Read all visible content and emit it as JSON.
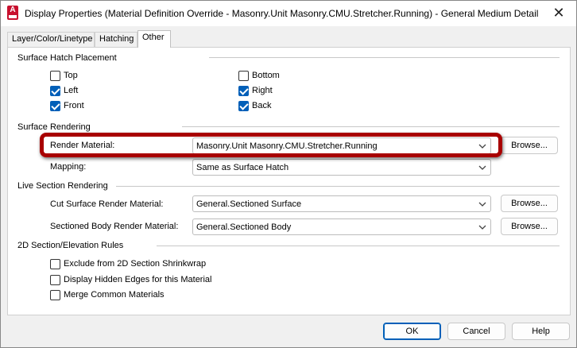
{
  "window": {
    "title": "Display Properties (Material Definition Override - Masonry.Unit Masonry.CMU.Stretcher.Running) - General Medium Detail",
    "app_icon": "autocad-icon",
    "close": "✕"
  },
  "tabs": [
    {
      "label": "Layer/Color/Linetype"
    },
    {
      "label": "Hatching"
    },
    {
      "label": "Other",
      "active": true
    }
  ],
  "surface_hatch": {
    "group_label": "Surface Hatch Placement",
    "options": {
      "top": {
        "label": "Top",
        "checked": false
      },
      "bottom": {
        "label": "Bottom",
        "checked": false
      },
      "left": {
        "label": "Left",
        "checked": true
      },
      "right": {
        "label": "Right",
        "checked": true
      },
      "front": {
        "label": "Front",
        "checked": true
      },
      "back": {
        "label": "Back",
        "checked": true
      }
    }
  },
  "surface_rendering": {
    "group_label": "Surface Rendering",
    "render_material_label": "Render Material:",
    "render_material_value": "Masonry.Unit Masonry.CMU.Stretcher.Running",
    "mapping_label": "Mapping:",
    "mapping_value": "Same as Surface Hatch",
    "browse_label": "Browse..."
  },
  "live_section": {
    "group_label": "Live Section Rendering",
    "cut_label": "Cut Surface Render Material:",
    "cut_value": "General.Sectioned Surface",
    "body_label": "Sectioned Body Render Material:",
    "body_value": "General.Sectioned Body",
    "browse_label": "Browse..."
  },
  "section_rules": {
    "group_label": "2D Section/Elevation Rules",
    "exclude": {
      "label": "Exclude from 2D Section Shrinkwrap",
      "checked": false
    },
    "hidden": {
      "label": "Display Hidden Edges for this Material",
      "checked": false
    },
    "merge": {
      "label": "Merge Common Materials",
      "checked": false
    }
  },
  "footer": {
    "ok": "OK",
    "cancel": "Cancel",
    "help": "Help"
  },
  "colors": {
    "accent": "#005fb8",
    "highlight": "#a80000"
  }
}
